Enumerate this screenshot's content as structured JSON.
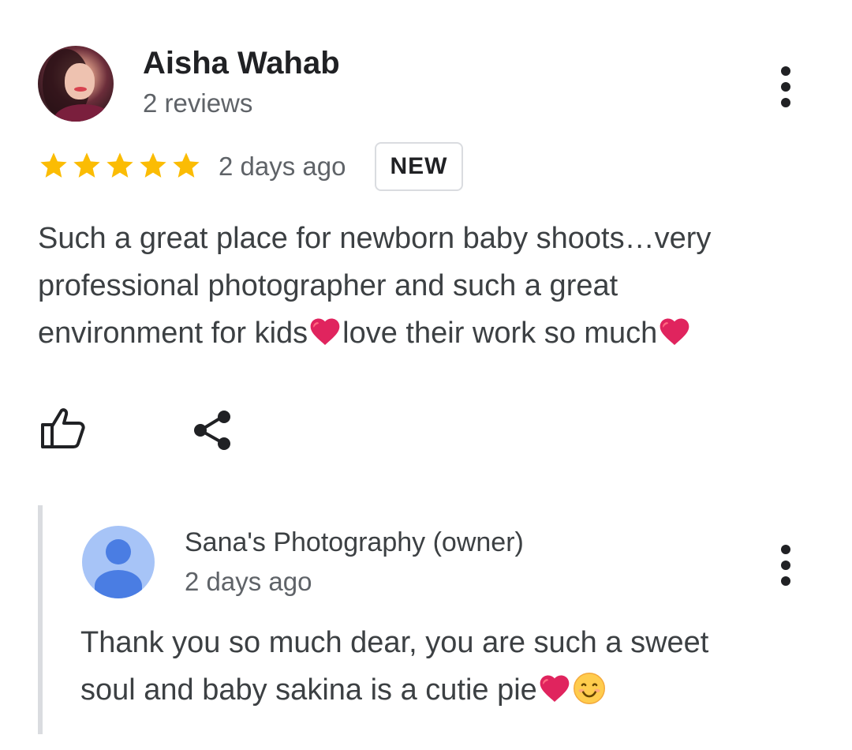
{
  "review": {
    "reviewer_name": "Aisha Wahab",
    "reviewer_meta": "2 reviews",
    "rating": 5,
    "rating_max": 5,
    "date": "2 days ago",
    "badge": "NEW",
    "text_line1": "Such a great place for newborn baby shoots…very",
    "text_line2": "professional photographer and such a great",
    "text_line3a": "environment for kids",
    "text_line3b": "love their work so much",
    "star_color": "#fbbc04",
    "more_icon": "more-vert-icon",
    "like_icon": "thumb-up-icon",
    "share_icon": "share-icon"
  },
  "owner_reply": {
    "name": "Sana's Photography (owner)",
    "date": "2 days ago",
    "text_line1": "Thank you so much dear, you are such a sweet",
    "text_line2": "soul and baby sakina is a cutie pie",
    "avatar_color": "#a7c4f7",
    "avatar_figure_color": "#4a7de3",
    "more_icon": "more-vert-icon"
  }
}
